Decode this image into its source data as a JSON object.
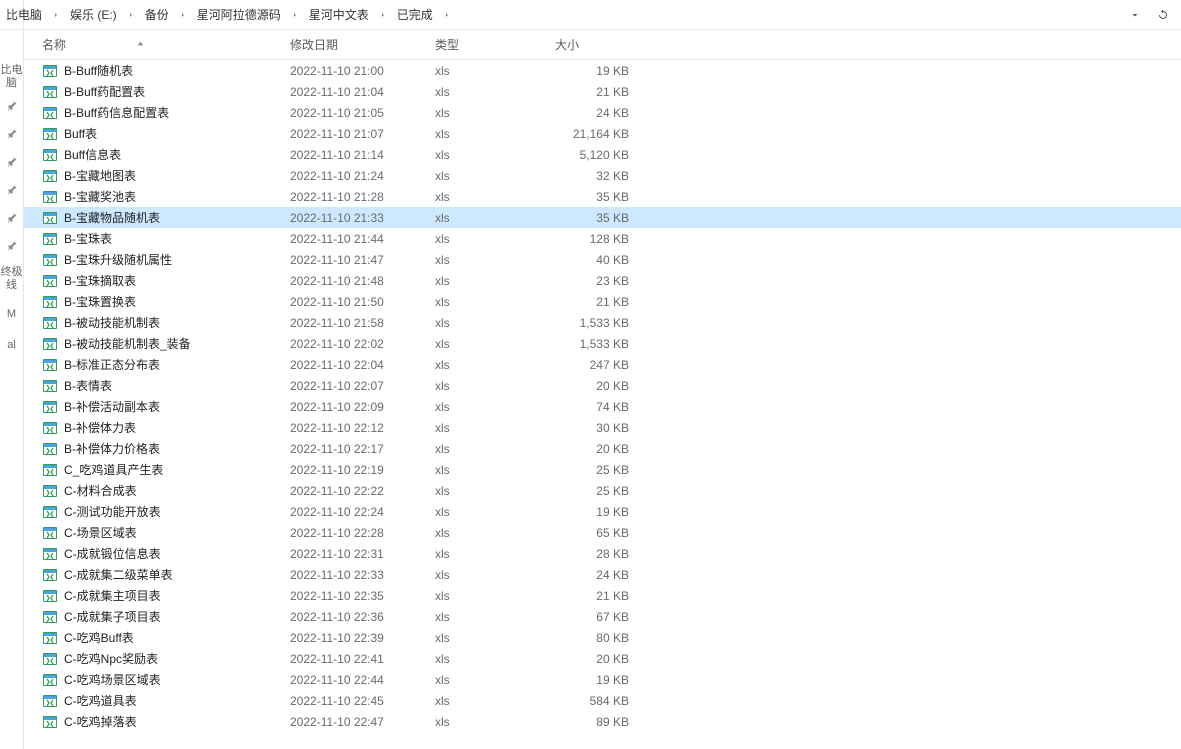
{
  "leftStrip": {
    "labels": [
      "比电脑",
      "终极线",
      "M",
      "al"
    ]
  },
  "breadcrumb": {
    "items": [
      "比电脑",
      "娱乐 (E:)",
      "备份",
      "星河阿拉德源码",
      "星河中文表",
      "已完成"
    ]
  },
  "columns": {
    "name": "名称",
    "date": "修改日期",
    "type": "类型",
    "size": "大小"
  },
  "selectedIndex": 7,
  "files": [
    {
      "name": "B-Buff随机表",
      "date": "2022-11-10 21:00",
      "type": "xls",
      "size": "19 KB"
    },
    {
      "name": "B-Buff药配置表",
      "date": "2022-11-10 21:04",
      "type": "xls",
      "size": "21 KB"
    },
    {
      "name": "B-Buff药信息配置表",
      "date": "2022-11-10 21:05",
      "type": "xls",
      "size": "24 KB"
    },
    {
      "name": "Buff表",
      "date": "2022-11-10 21:07",
      "type": "xls",
      "size": "21,164 KB"
    },
    {
      "name": "Buff信息表",
      "date": "2022-11-10 21:14",
      "type": "xls",
      "size": "5,120 KB"
    },
    {
      "name": "B-宝藏地图表",
      "date": "2022-11-10 21:24",
      "type": "xls",
      "size": "32 KB"
    },
    {
      "name": "B-宝藏奖池表",
      "date": "2022-11-10 21:28",
      "type": "xls",
      "size": "35 KB"
    },
    {
      "name": "B-宝藏物品随机表",
      "date": "2022-11-10 21:33",
      "type": "xls",
      "size": "35 KB"
    },
    {
      "name": "B-宝珠表",
      "date": "2022-11-10 21:44",
      "type": "xls",
      "size": "128 KB"
    },
    {
      "name": "B-宝珠升级随机属性",
      "date": "2022-11-10 21:47",
      "type": "xls",
      "size": "40 KB"
    },
    {
      "name": "B-宝珠摘取表",
      "date": "2022-11-10 21:48",
      "type": "xls",
      "size": "23 KB"
    },
    {
      "name": "B-宝珠置换表",
      "date": "2022-11-10 21:50",
      "type": "xls",
      "size": "21 KB"
    },
    {
      "name": "B-被动技能机制表",
      "date": "2022-11-10 21:58",
      "type": "xls",
      "size": "1,533 KB"
    },
    {
      "name": "B-被动技能机制表_装备",
      "date": "2022-11-10 22:02",
      "type": "xls",
      "size": "1,533 KB"
    },
    {
      "name": "B-标准正态分布表",
      "date": "2022-11-10 22:04",
      "type": "xls",
      "size": "247 KB"
    },
    {
      "name": "B-表情表",
      "date": "2022-11-10 22:07",
      "type": "xls",
      "size": "20 KB"
    },
    {
      "name": "B-补偿活动副本表",
      "date": "2022-11-10 22:09",
      "type": "xls",
      "size": "74 KB"
    },
    {
      "name": "B-补偿体力表",
      "date": "2022-11-10 22:12",
      "type": "xls",
      "size": "30 KB"
    },
    {
      "name": "B-补偿体力价格表",
      "date": "2022-11-10 22:17",
      "type": "xls",
      "size": "20 KB"
    },
    {
      "name": "C_吃鸡道具产生表",
      "date": "2022-11-10 22:19",
      "type": "xls",
      "size": "25 KB"
    },
    {
      "name": "C-材料合成表",
      "date": "2022-11-10 22:22",
      "type": "xls",
      "size": "25 KB"
    },
    {
      "name": "C-测试功能开放表",
      "date": "2022-11-10 22:24",
      "type": "xls",
      "size": "19 KB"
    },
    {
      "name": "C-场景区域表",
      "date": "2022-11-10 22:28",
      "type": "xls",
      "size": "65 KB"
    },
    {
      "name": "C-成就锻位信息表",
      "date": "2022-11-10 22:31",
      "type": "xls",
      "size": "28 KB"
    },
    {
      "name": "C-成就集二级菜单表",
      "date": "2022-11-10 22:33",
      "type": "xls",
      "size": "24 KB"
    },
    {
      "name": "C-成就集主项目表",
      "date": "2022-11-10 22:35",
      "type": "xls",
      "size": "21 KB"
    },
    {
      "name": "C-成就集子项目表",
      "date": "2022-11-10 22:36",
      "type": "xls",
      "size": "67 KB"
    },
    {
      "name": "C-吃鸡Buff表",
      "date": "2022-11-10 22:39",
      "type": "xls",
      "size": "80 KB"
    },
    {
      "name": "C-吃鸡Npc奖励表",
      "date": "2022-11-10 22:41",
      "type": "xls",
      "size": "20 KB"
    },
    {
      "name": "C-吃鸡场景区域表",
      "date": "2022-11-10 22:44",
      "type": "xls",
      "size": "19 KB"
    },
    {
      "name": "C-吃鸡道具表",
      "date": "2022-11-10 22:45",
      "type": "xls",
      "size": "584 KB"
    },
    {
      "name": "C-吃鸡掉落表",
      "date": "2022-11-10 22:47",
      "type": "xls",
      "size": "89 KB"
    }
  ]
}
